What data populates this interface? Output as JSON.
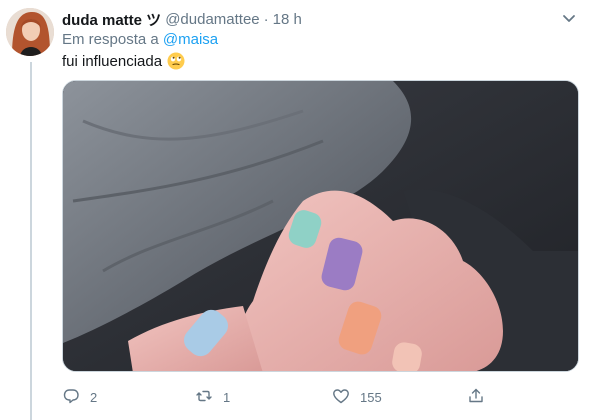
{
  "tweet": {
    "author_name": "duda matte ツ",
    "author_handle": "@dudamattee",
    "separator": "·",
    "time": "18 h",
    "reply_prefix": "Em resposta a",
    "reply_mention": "@maisa",
    "text": "fui influenciada",
    "emoji": "rolling-eyes-emoji"
  },
  "media": {
    "description_icon": "photo"
  },
  "actions": {
    "replies": "2",
    "retweets": "1",
    "likes": "155"
  },
  "colors": {
    "link": "#1da1f2",
    "secondary_text": "#657786",
    "thread_line": "#ccd6dd"
  }
}
